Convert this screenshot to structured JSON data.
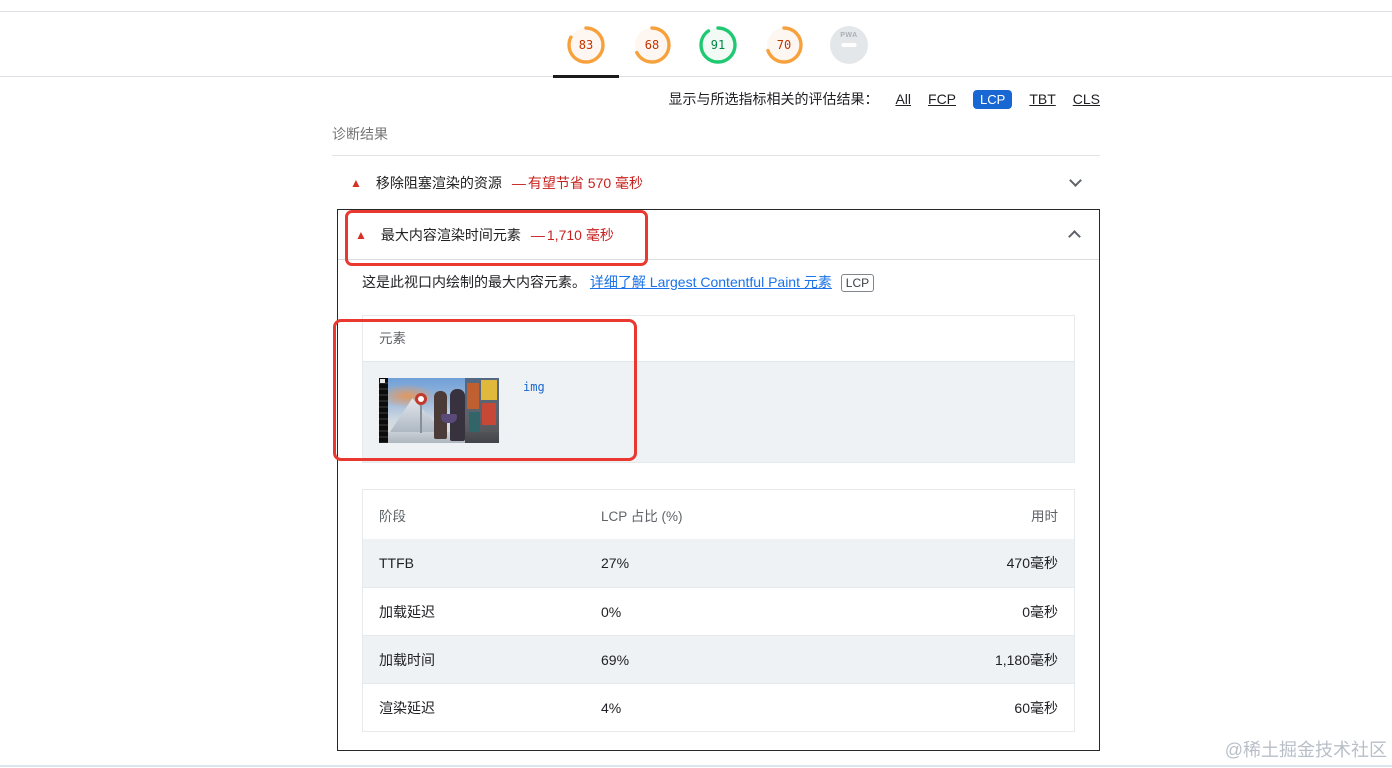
{
  "header": {
    "gauges": [
      {
        "name": "performance",
        "score": "83",
        "status": "average",
        "active": true
      },
      {
        "name": "accessibility",
        "score": "68",
        "status": "average",
        "active": false
      },
      {
        "name": "best-practices",
        "score": "91",
        "status": "good",
        "active": false
      },
      {
        "name": "seo",
        "score": "70",
        "status": "average",
        "active": false
      }
    ],
    "pwa": {
      "label": "PWA"
    }
  },
  "filter": {
    "label": "显示与所选指标相关的评估结果：",
    "options": [
      {
        "label": "All",
        "selected": false
      },
      {
        "label": "FCP",
        "selected": false
      },
      {
        "label": "LCP",
        "selected": true
      },
      {
        "label": "TBT",
        "selected": false
      },
      {
        "label": "CLS",
        "selected": false
      }
    ]
  },
  "diagnostics": {
    "heading": "诊断结果",
    "collapsed_audit": {
      "title": "移除阻塞渲染的资源",
      "separator": "—",
      "savings": "有望节省 570 毫秒"
    },
    "expanded_audit": {
      "title": "最大内容渲染时间元素",
      "separator": "—",
      "value": "1,710 毫秒",
      "description": "这是此视口内绘制的最大内容元素。",
      "link_text": "详细了解 Largest Contentful Paint 元素",
      "chip": "LCP",
      "element_table": {
        "header": "元素",
        "node_tag": "img"
      },
      "phases_table": {
        "headers": [
          "阶段",
          "LCP 占比 (%)",
          "用时"
        ],
        "rows": [
          {
            "phase": "TTFB",
            "percent": "27%",
            "timing": "470毫秒"
          },
          {
            "phase": "加载延迟",
            "percent": "0%",
            "timing": "0毫秒"
          },
          {
            "phase": "加载时间",
            "percent": "69%",
            "timing": "1,180毫秒"
          },
          {
            "phase": "渲染延迟",
            "percent": "4%",
            "timing": "60毫秒"
          }
        ]
      }
    }
  },
  "watermark": "@稀土掘金技术社区",
  "colors": {
    "accent_blue": "#1967d2",
    "score_orange": "#f7a13d",
    "score_green": "#1ec971",
    "alert_red": "#c7221f",
    "annotation_red": "#e8382f"
  }
}
